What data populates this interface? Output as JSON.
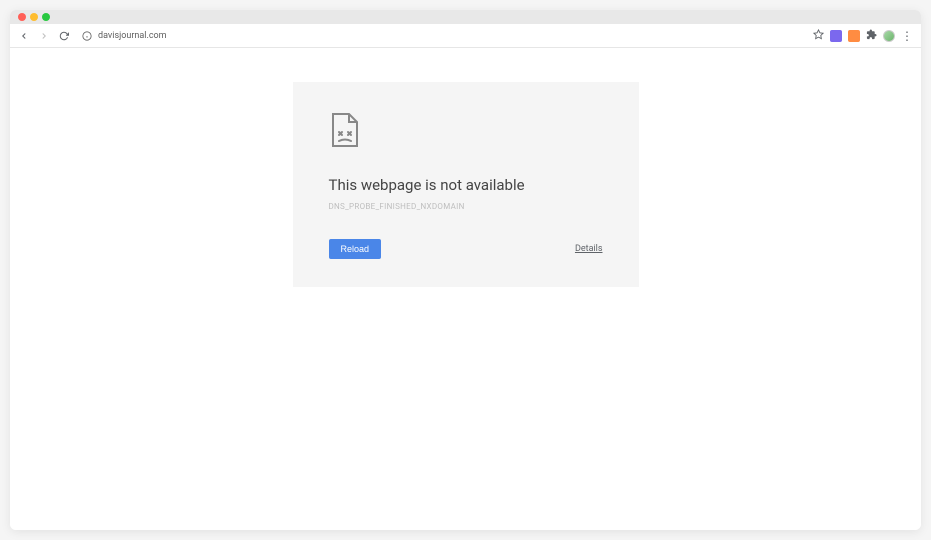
{
  "address_bar": {
    "url": "davisjournal.com"
  },
  "error": {
    "title": "This webpage is not available",
    "code": "DNS_PROBE_FINISHED_NXDOMAIN",
    "reload_label": "Reload",
    "details_label": "Details"
  }
}
